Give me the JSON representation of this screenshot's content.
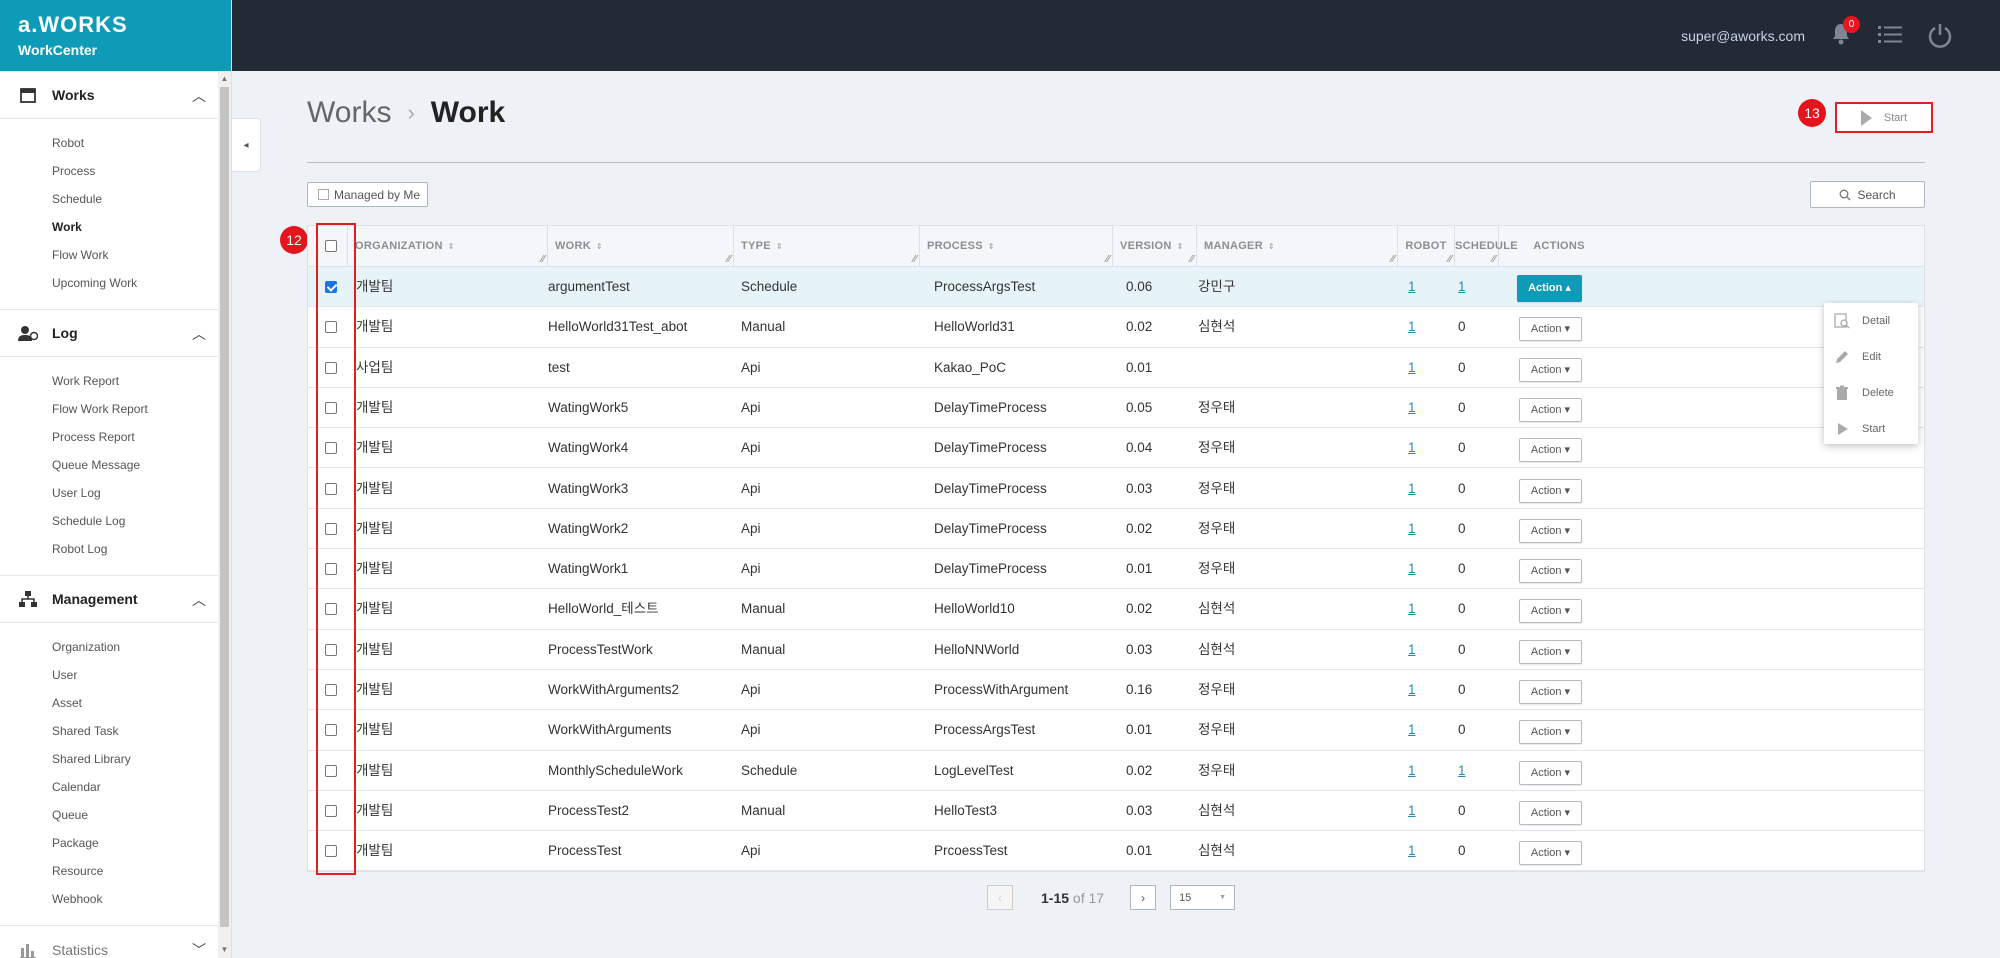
{
  "brand": {
    "logo": "a.WORKS",
    "subtitle": "WorkCenter"
  },
  "user": {
    "email": "super@aworks.com",
    "notification_count": "0"
  },
  "sidebar": {
    "sections": [
      {
        "title": "Works",
        "icon": "calendar-icon",
        "items": [
          "Robot",
          "Process",
          "Schedule",
          "Work",
          "Flow Work",
          "Upcoming Work"
        ],
        "active": "Work"
      },
      {
        "title": "Log",
        "icon": "user-log-icon",
        "items": [
          "Work Report",
          "Flow Work Report",
          "Process Report",
          "Queue Message",
          "User Log",
          "Schedule Log",
          "Robot Log"
        ]
      },
      {
        "title": "Management",
        "icon": "sitemap-icon",
        "items": [
          "Organization",
          "User",
          "Asset",
          "Shared Task",
          "Shared Library",
          "Calendar",
          "Queue",
          "Package",
          "Resource",
          "Webhook"
        ]
      },
      {
        "title": "Statistics",
        "icon": "bar-chart-icon",
        "items": []
      }
    ]
  },
  "header": {
    "breadcrumb": "Works",
    "separator": "›",
    "title": "Work"
  },
  "toolbar": {
    "start_label": "Start",
    "managed_label": "Managed by Me",
    "search_label": "Search"
  },
  "markers": {
    "checkbox_column": "12",
    "start_button": "13"
  },
  "table": {
    "columns": [
      "ORGANIZATION",
      "WORK",
      "TYPE",
      "PROCESS",
      "VERSION",
      "MANAGER",
      "ROBOT",
      "SCHEDULE",
      "ACTIONS"
    ],
    "action_label": "Action",
    "rows": [
      {
        "org": "개발팀",
        "work": "argumentTest",
        "type": "Schedule",
        "process": "ProcessArgsTest",
        "version": "0.06",
        "manager": "강민구",
        "robot": "1",
        "schedule": "1",
        "checked": true
      },
      {
        "org": "개발팀",
        "work": "HelloWorld31Test_abot",
        "type": "Manual",
        "process": "HelloWorld31",
        "version": "0.02",
        "manager": "심현석",
        "robot": "1",
        "schedule": "0"
      },
      {
        "org": "사업팀",
        "work": "test",
        "type": "Api",
        "process": "Kakao_PoC",
        "version": "0.01",
        "manager": "",
        "robot": "1",
        "schedule": "0"
      },
      {
        "org": "개발팀",
        "work": "WatingWork5",
        "type": "Api",
        "process": "DelayTimeProcess",
        "version": "0.05",
        "manager": "정우태",
        "robot": "1",
        "schedule": "0"
      },
      {
        "org": "개발팀",
        "work": "WatingWork4",
        "type": "Api",
        "process": "DelayTimeProcess",
        "version": "0.04",
        "manager": "정우태",
        "robot": "1",
        "schedule": "0"
      },
      {
        "org": "개발팀",
        "work": "WatingWork3",
        "type": "Api",
        "process": "DelayTimeProcess",
        "version": "0.03",
        "manager": "정우태",
        "robot": "1",
        "schedule": "0"
      },
      {
        "org": "개발팀",
        "work": "WatingWork2",
        "type": "Api",
        "process": "DelayTimeProcess",
        "version": "0.02",
        "manager": "정우태",
        "robot": "1",
        "schedule": "0"
      },
      {
        "org": "개발팀",
        "work": "WatingWork1",
        "type": "Api",
        "process": "DelayTimeProcess",
        "version": "0.01",
        "manager": "정우태",
        "robot": "1",
        "schedule": "0"
      },
      {
        "org": "개발팀",
        "work": "HelloWorld_테스트",
        "type": "Manual",
        "process": "HelloWorld10",
        "version": "0.02",
        "manager": "심현석",
        "robot": "1",
        "schedule": "0"
      },
      {
        "org": "개발팀",
        "work": "ProcessTestWork",
        "type": "Manual",
        "process": "HelloNNWorld",
        "version": "0.03",
        "manager": "심현석",
        "robot": "1",
        "schedule": "0"
      },
      {
        "org": "개발팀",
        "work": "WorkWithArguments2",
        "type": "Api",
        "process": "ProcessWithArgument",
        "version": "0.16",
        "manager": "정우태",
        "robot": "1",
        "schedule": "0"
      },
      {
        "org": "개발팀",
        "work": "WorkWithArguments",
        "type": "Api",
        "process": "ProcessArgsTest",
        "version": "0.01",
        "manager": "정우태",
        "robot": "1",
        "schedule": "0"
      },
      {
        "org": "개발팀",
        "work": "MonthlyScheduleWork",
        "type": "Schedule",
        "process": "LogLevelTest",
        "version": "0.02",
        "manager": "정우태",
        "robot": "1",
        "schedule": "1"
      },
      {
        "org": "개발팀",
        "work": "ProcessTest2",
        "type": "Manual",
        "process": "HelloTest3",
        "version": "0.03",
        "manager": "심현석",
        "robot": "1",
        "schedule": "0"
      },
      {
        "org": "개발팀",
        "work": "ProcessTest",
        "type": "Api",
        "process": "PrcoessTest",
        "version": "0.01",
        "manager": "심현석",
        "robot": "1",
        "schedule": "0"
      }
    ]
  },
  "action_menu": {
    "items": [
      {
        "label": "Detail",
        "icon": "detail-icon"
      },
      {
        "label": "Edit",
        "icon": "edit-icon"
      },
      {
        "label": "Delete",
        "icon": "trash-icon"
      },
      {
        "label": "Start",
        "icon": "play-icon"
      }
    ]
  },
  "pagination": {
    "range": "1-15",
    "of_label": "of 17",
    "page_size": "15"
  }
}
